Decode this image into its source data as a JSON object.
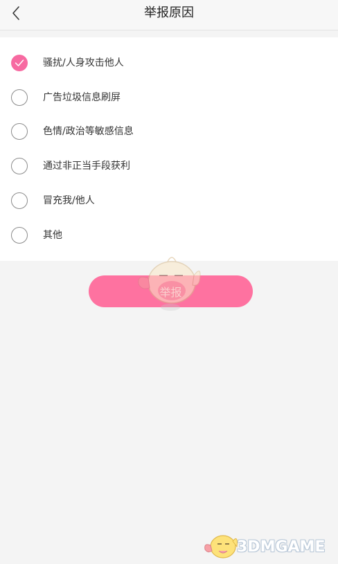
{
  "header": {
    "title": "举报原因",
    "back_icon": "chevron-left-icon"
  },
  "reasons": [
    {
      "label": "骚扰/人身攻击他人",
      "checked": true
    },
    {
      "label": "广告垃圾信息刷屏",
      "checked": false
    },
    {
      "label": "色情/政治等敏感信息",
      "checked": false
    },
    {
      "label": "通过非正当手段获利",
      "checked": false
    },
    {
      "label": "冒充我/他人",
      "checked": false
    },
    {
      "label": "其他",
      "checked": false
    }
  ],
  "submit": {
    "label": "举报"
  },
  "watermark": {
    "logo_text": "3DMGAME"
  },
  "colors": {
    "accent": "#fe72a0",
    "radio_checked": "#f76aa1",
    "background": "#f4f4f4",
    "list_background": "#ffffff"
  }
}
